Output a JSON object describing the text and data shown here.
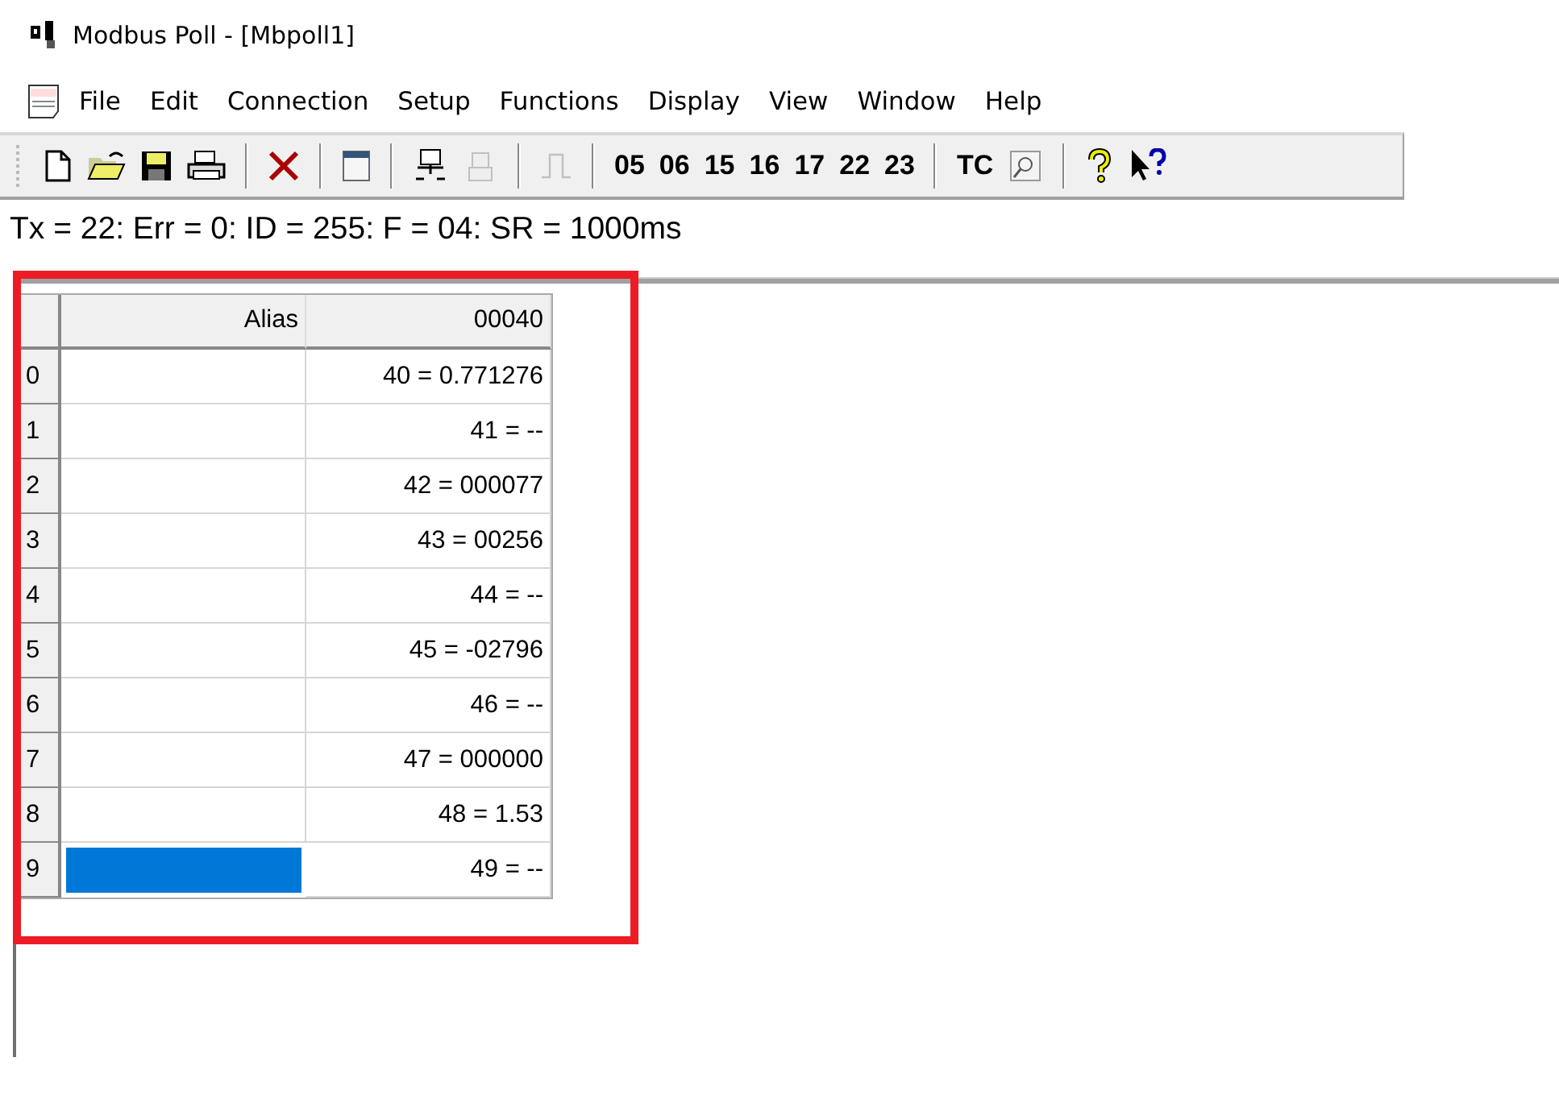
{
  "window": {
    "title": "Modbus Poll - [Mbpoll1]"
  },
  "menu": [
    "File",
    "Edit",
    "Connection",
    "Setup",
    "Functions",
    "Display",
    "View",
    "Window",
    "Help"
  ],
  "toolbar": [
    {
      "kind": "icon"
    },
    {
      "kind": "icon"
    },
    {
      "kind": "icon"
    },
    {
      "kind": "icon"
    },
    {
      "kind": "sep"
    },
    {
      "kind": "icon"
    },
    {
      "kind": "sep"
    },
    {
      "kind": "icon"
    },
    {
      "kind": "sep"
    },
    {
      "kind": "icon",
      "disabled": false
    },
    {
      "kind": "icon",
      "disabled": true
    },
    {
      "kind": "sep"
    },
    {
      "kind": "icon",
      "disabled": true
    },
    {
      "kind": "sep"
    },
    {
      "kind": "text",
      "label": "05"
    },
    {
      "kind": "text",
      "label": "06"
    },
    {
      "kind": "text",
      "label": "15"
    },
    {
      "kind": "text",
      "label": "16"
    },
    {
      "kind": "text",
      "label": "17"
    },
    {
      "kind": "text",
      "label": "22"
    },
    {
      "kind": "text",
      "label": "23"
    },
    {
      "kind": "sep"
    },
    {
      "kind": "text",
      "label": "TC"
    },
    {
      "kind": "icon"
    },
    {
      "kind": "sep"
    },
    {
      "kind": "icon"
    },
    {
      "kind": "icon"
    }
  ],
  "status_line": "Tx = 22: Err = 0: ID = 255: F = 04: SR = 1000ms",
  "table": {
    "columns": [
      "Alias",
      "00040"
    ],
    "rows": [
      {
        "index": "0",
        "value": "40 = 0.771276",
        "selected": false
      },
      {
        "index": "1",
        "value": "41 = --",
        "selected": false
      },
      {
        "index": "2",
        "value": "42 = 000077",
        "selected": false
      },
      {
        "index": "3",
        "value": "43 = 00256",
        "selected": false
      },
      {
        "index": "4",
        "value": "44 = --",
        "selected": false
      },
      {
        "index": "5",
        "value": "45 = -02796",
        "selected": false
      },
      {
        "index": "6",
        "value": "46 = --",
        "selected": false
      },
      {
        "index": "7",
        "value": "47 = 000000",
        "selected": false
      },
      {
        "index": "8",
        "value": "48 = 1.53",
        "selected": false
      },
      {
        "index": "9",
        "value": "49 = --",
        "selected": true
      }
    ]
  },
  "annotation": {
    "color": "#ed1c24"
  }
}
